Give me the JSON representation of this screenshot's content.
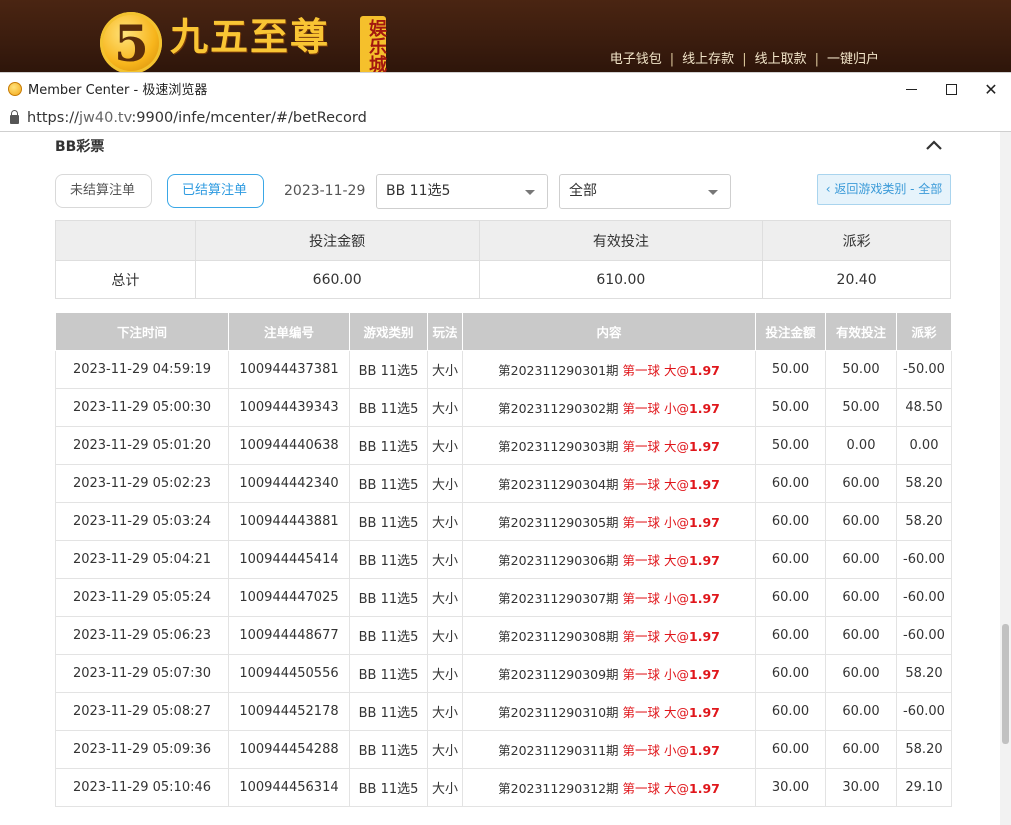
{
  "banner": {
    "logo_numeral": "5",
    "logo_text": "九五至尊",
    "logo_tag": "娱乐城",
    "links": [
      "电子钱包",
      "线上存款",
      "线上取款",
      "一键归户"
    ]
  },
  "window": {
    "title": "Member Center - 极速浏览器",
    "url_scheme": "https://",
    "url_host": "jw40.tv",
    "url_rest": ":9900/infe/mcenter/#/betRecord"
  },
  "section": {
    "title": "BB彩票"
  },
  "filters": {
    "unsettled_label": "未结算注单",
    "settled_label": "已结算注单",
    "date": "2023-11-29",
    "game_select": "BB 11选5",
    "type_select": "全部",
    "back_label": "‹ 返回游戏类别 - 全部"
  },
  "summary": {
    "headers": [
      "",
      "投注金额",
      "有效投注",
      "派彩"
    ],
    "row": [
      "总计",
      "660.00",
      "610.00",
      "20.40"
    ]
  },
  "records": {
    "headers": [
      "下注时间",
      "注单编号",
      "游戏类别",
      "玩法",
      "内容",
      "投注金额",
      "有效投注",
      "派彩"
    ],
    "rows": [
      {
        "time": "2023-11-29 04:59:19",
        "id": "100944437381",
        "game": "BB 11选5",
        "play": "大小",
        "period": "第202311290301期",
        "pick": "第一球 大@",
        "odds": "1.97",
        "bet": "50.00",
        "valid": "50.00",
        "payout": "-50.00",
        "neg": true
      },
      {
        "time": "2023-11-29 05:00:30",
        "id": "100944439343",
        "game": "BB 11选5",
        "play": "大小",
        "period": "第202311290302期",
        "pick": "第一球 小@",
        "odds": "1.97",
        "bet": "50.00",
        "valid": "50.00",
        "payout": "48.50",
        "neg": false
      },
      {
        "time": "2023-11-29 05:01:20",
        "id": "100944440638",
        "game": "BB 11选5",
        "play": "大小",
        "period": "第202311290303期",
        "pick": "第一球 大@",
        "odds": "1.97",
        "bet": "50.00",
        "valid": "0.00",
        "payout": "0.00",
        "neg": false
      },
      {
        "time": "2023-11-29 05:02:23",
        "id": "100944442340",
        "game": "BB 11选5",
        "play": "大小",
        "period": "第202311290304期",
        "pick": "第一球 大@",
        "odds": "1.97",
        "bet": "60.00",
        "valid": "60.00",
        "payout": "58.20",
        "neg": false
      },
      {
        "time": "2023-11-29 05:03:24",
        "id": "100944443881",
        "game": "BB 11选5",
        "play": "大小",
        "period": "第202311290305期",
        "pick": "第一球 小@",
        "odds": "1.97",
        "bet": "60.00",
        "valid": "60.00",
        "payout": "58.20",
        "neg": false
      },
      {
        "time": "2023-11-29 05:04:21",
        "id": "100944445414",
        "game": "BB 11选5",
        "play": "大小",
        "period": "第202311290306期",
        "pick": "第一球 大@",
        "odds": "1.97",
        "bet": "60.00",
        "valid": "60.00",
        "payout": "-60.00",
        "neg": true
      },
      {
        "time": "2023-11-29 05:05:24",
        "id": "100944447025",
        "game": "BB 11选5",
        "play": "大小",
        "period": "第202311290307期",
        "pick": "第一球 小@",
        "odds": "1.97",
        "bet": "60.00",
        "valid": "60.00",
        "payout": "-60.00",
        "neg": true
      },
      {
        "time": "2023-11-29 05:06:23",
        "id": "100944448677",
        "game": "BB 11选5",
        "play": "大小",
        "period": "第202311290308期",
        "pick": "第一球 大@",
        "odds": "1.97",
        "bet": "60.00",
        "valid": "60.00",
        "payout": "-60.00",
        "neg": true
      },
      {
        "time": "2023-11-29 05:07:30",
        "id": "100944450556",
        "game": "BB 11选5",
        "play": "大小",
        "period": "第202311290309期",
        "pick": "第一球 小@",
        "odds": "1.97",
        "bet": "60.00",
        "valid": "60.00",
        "payout": "58.20",
        "neg": false
      },
      {
        "time": "2023-11-29 05:08:27",
        "id": "100944452178",
        "game": "BB 11选5",
        "play": "大小",
        "period": "第202311290310期",
        "pick": "第一球 大@",
        "odds": "1.97",
        "bet": "60.00",
        "valid": "60.00",
        "payout": "-60.00",
        "neg": true
      },
      {
        "time": "2023-11-29 05:09:36",
        "id": "100944454288",
        "game": "BB 11选5",
        "play": "大小",
        "period": "第202311290311期",
        "pick": "第一球 小@",
        "odds": "1.97",
        "bet": "60.00",
        "valid": "60.00",
        "payout": "58.20",
        "neg": false
      },
      {
        "time": "2023-11-29 05:10:46",
        "id": "100944456314",
        "game": "BB 11选5",
        "play": "大小",
        "period": "第202311290312期",
        "pick": "第一球 大@",
        "odds": "1.97",
        "bet": "30.00",
        "valid": "30.00",
        "payout": "29.10",
        "neg": false
      }
    ]
  }
}
